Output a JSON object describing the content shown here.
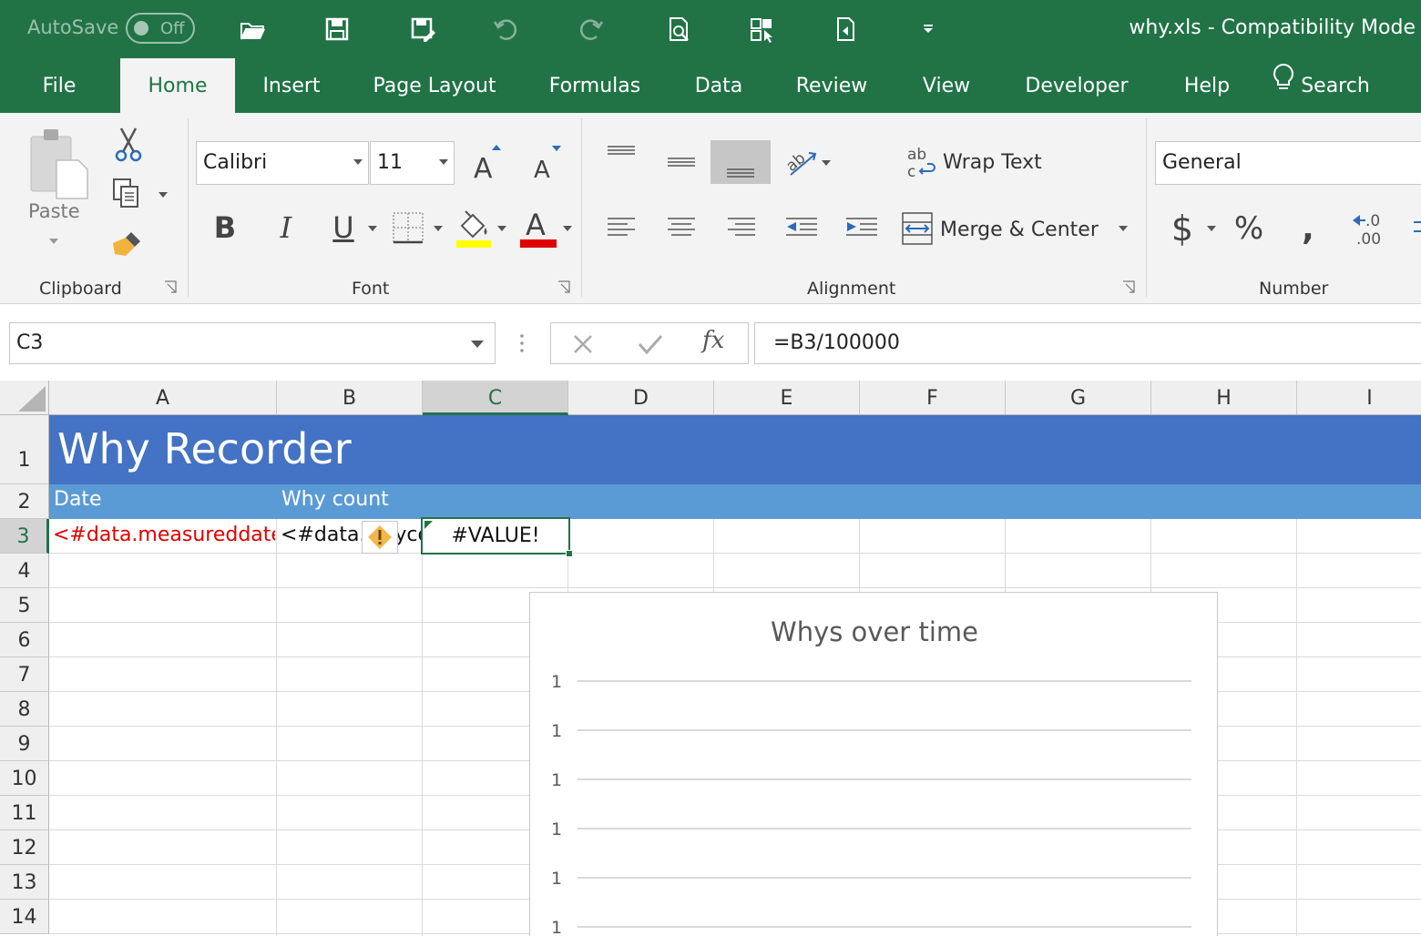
{
  "titlebar": {
    "autosave_label": "AutoSave",
    "autosave_state": "Off",
    "doc_title": "why.xls  -  Compatibility Mode"
  },
  "tabs": [
    {
      "label": "File"
    },
    {
      "label": "Home"
    },
    {
      "label": "Insert"
    },
    {
      "label": "Page Layout"
    },
    {
      "label": "Formulas"
    },
    {
      "label": "Data"
    },
    {
      "label": "Review"
    },
    {
      "label": "View"
    },
    {
      "label": "Developer"
    },
    {
      "label": "Help"
    },
    {
      "label": "Search"
    }
  ],
  "ribbon": {
    "clipboard": {
      "label": "Clipboard",
      "paste_label": "Paste"
    },
    "font": {
      "label": "Font",
      "font_name": "Calibri",
      "font_size": "11",
      "highlight_color": "#ffff00",
      "font_color": "#e00000"
    },
    "alignment": {
      "label": "Alignment",
      "wrap_text": "Wrap Text",
      "merge_center": "Merge & Center"
    },
    "number": {
      "label": "Number",
      "format": "General"
    }
  },
  "formula_bar": {
    "name_box": "C3",
    "formula": "=B3/100000"
  },
  "sheet": {
    "columns": [
      "A",
      "B",
      "C",
      "D",
      "E",
      "F",
      "G",
      "H",
      "I"
    ],
    "rows": [
      "1",
      "2",
      "3",
      "4",
      "5",
      "6",
      "7",
      "8",
      "9",
      "10",
      "11",
      "12",
      "13",
      "14"
    ],
    "title": "Why Recorder",
    "header_date": "Date",
    "header_count": "Why count",
    "a3": "<#data.measureddate>",
    "b3": "<#data.whycount>",
    "c3": "#VALUE!",
    "colors": {
      "title_band": "#4472c4",
      "header_band": "#5b9bd5",
      "accent": "#217346",
      "a3_text": "#e00000"
    }
  },
  "chart_data": {
    "type": "line",
    "title": "Whys over time",
    "y_tick_labels": [
      "1",
      "1",
      "1",
      "1",
      "1",
      "1"
    ],
    "series": []
  }
}
